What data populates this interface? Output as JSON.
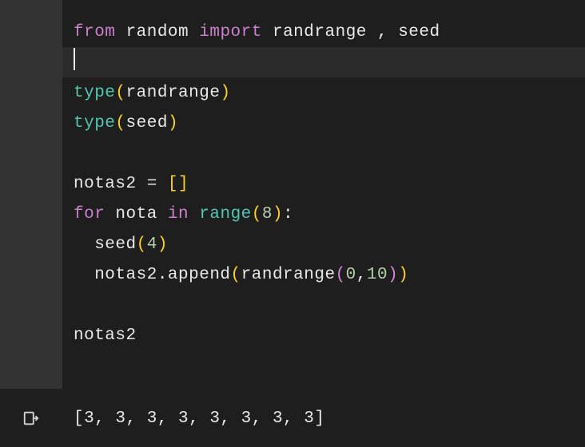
{
  "code": {
    "l1_from": "from",
    "l1_random": " random ",
    "l1_import": "import",
    "l1_rest": " randrange , seed",
    "l3_type": "type",
    "l3_p1": "(",
    "l3_randrange": "randrange",
    "l3_p2": ")",
    "l4_type": "type",
    "l4_p1": "(",
    "l4_seed": "seed",
    "l4_p2": ")",
    "l6_var": "notas2 = ",
    "l6_b1": "[",
    "l6_b2": "]",
    "l7_for": "for",
    "l7_nota": " nota ",
    "l7_in": "in",
    "l7_sp": " ",
    "l7_range": "range",
    "l7_p1": "(",
    "l7_8": "8",
    "l7_p2": ")",
    "l7_colon": ":",
    "l8_indent": "  seed",
    "l8_p1": "(",
    "l8_4": "4",
    "l8_p2": ")",
    "l9_indent": "  notas2.append",
    "l9_p1": "(",
    "l9_fn": "randrange",
    "l9_p2": "(",
    "l9_0": "0",
    "l9_comma": ",",
    "l9_10": "10",
    "l9_p3": ")",
    "l9_p4": ")",
    "l11": "notas2"
  },
  "output": {
    "text": "[3, 3, 3, 3, 3, 3, 3, 3]"
  }
}
